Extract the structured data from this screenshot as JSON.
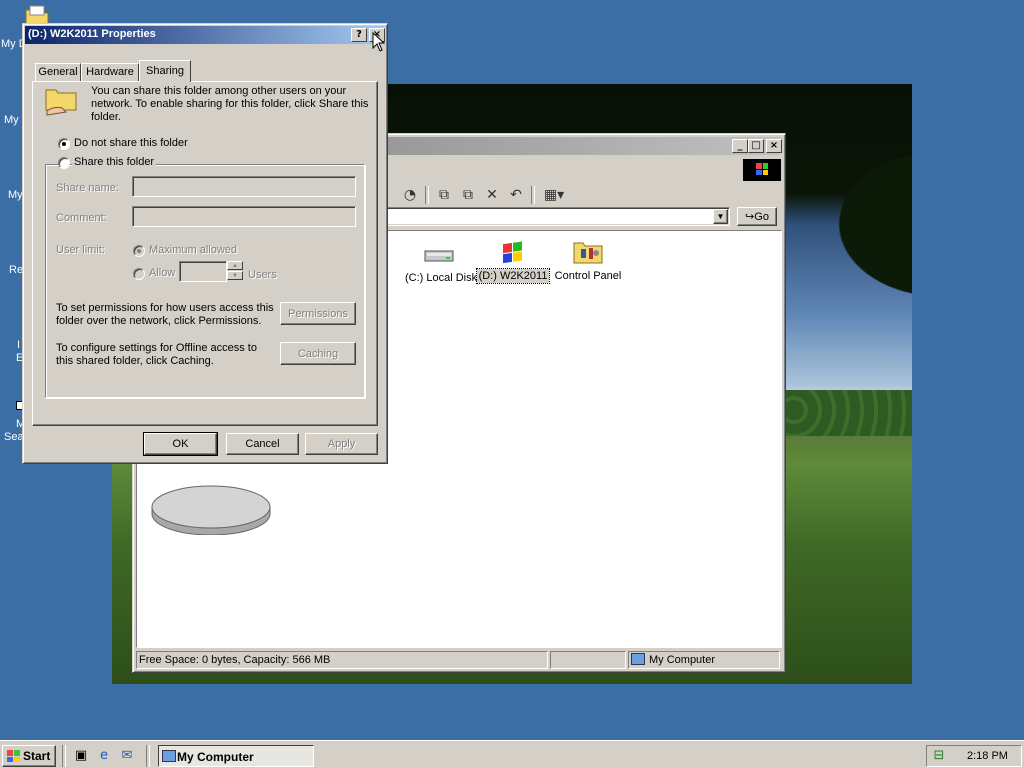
{
  "desktop": {
    "labels": [
      "My D",
      "My",
      "My",
      "Re",
      "I",
      "E",
      "M",
      "Sea"
    ]
  },
  "explorer": {
    "address_value": "",
    "go_label": "Go",
    "items": [
      {
        "label": "(C:) Local Disk",
        "icon": "hard-drive-icon"
      },
      {
        "label": "(D:) W2K2011",
        "icon": "cd-drive-icon"
      },
      {
        "label": "Control Panel",
        "icon": "control-panel-icon"
      }
    ],
    "status": {
      "free_space": "Free Space: 0 bytes, Capacity: 566 MB",
      "zone": "My Computer"
    }
  },
  "dialog": {
    "title": "(D:) W2K2011 Properties",
    "help_label": "?",
    "close_label": "×",
    "tabs": [
      "General",
      "Hardware",
      "Sharing"
    ],
    "intro_text": "You can share this folder among other users on your network.  To enable sharing for this folder, click Share this folder.",
    "radio_no_share": "Do not share this folder",
    "radio_share": "Share this folder",
    "share_name_label": "Share name:",
    "comment_label": "Comment:",
    "user_limit_label": "User limit:",
    "max_allowed_label": "Maximum allowed",
    "allow_label": "Allow",
    "users_label": "Users",
    "permissions_text": "To set permissions for how users access this folder over the network, click Permissions.",
    "permissions_button": "Permissions",
    "caching_text": "To configure settings for Offline access to this shared folder, click Caching.",
    "caching_button": "Caching",
    "ok": "OK",
    "cancel": "Cancel",
    "apply": "Apply"
  },
  "taskbar": {
    "start_label": "Start",
    "task_label": "My Computer",
    "clock": "2:18 PM"
  },
  "colors": {
    "desktop": "#3a6ea5",
    "title_active": "#0a246a",
    "title_inactive": "#808080",
    "face": "#d4d0c8"
  }
}
